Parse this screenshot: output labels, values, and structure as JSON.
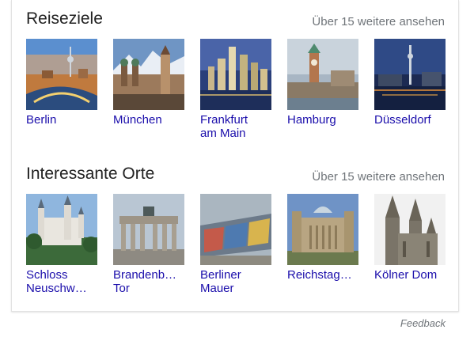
{
  "sections": [
    {
      "title": "Reiseziele",
      "more": "Über 15 weitere ansehen",
      "items": [
        {
          "line1": "Berlin",
          "line2": ""
        },
        {
          "line1": "München",
          "line2": ""
        },
        {
          "line1": "Frankfurt",
          "line2": "am Main"
        },
        {
          "line1": "Hamburg",
          "line2": ""
        },
        {
          "line1": "Düsseldorf",
          "line2": ""
        }
      ]
    },
    {
      "title": "Interessante Orte",
      "more": "Über 15 weitere ansehen",
      "items": [
        {
          "line1": "Schloss",
          "line2": "Neuschw…"
        },
        {
          "line1": "Brandenb…",
          "line2": "Tor"
        },
        {
          "line1": "Berliner",
          "line2": "Mauer"
        },
        {
          "line1": "Reichstag…",
          "line2": ""
        },
        {
          "line1": "Kölner Dom",
          "line2": ""
        }
      ]
    }
  ],
  "feedback": "Feedback",
  "colors": {
    "link": "#1a0dab",
    "muted": "#70757a"
  }
}
